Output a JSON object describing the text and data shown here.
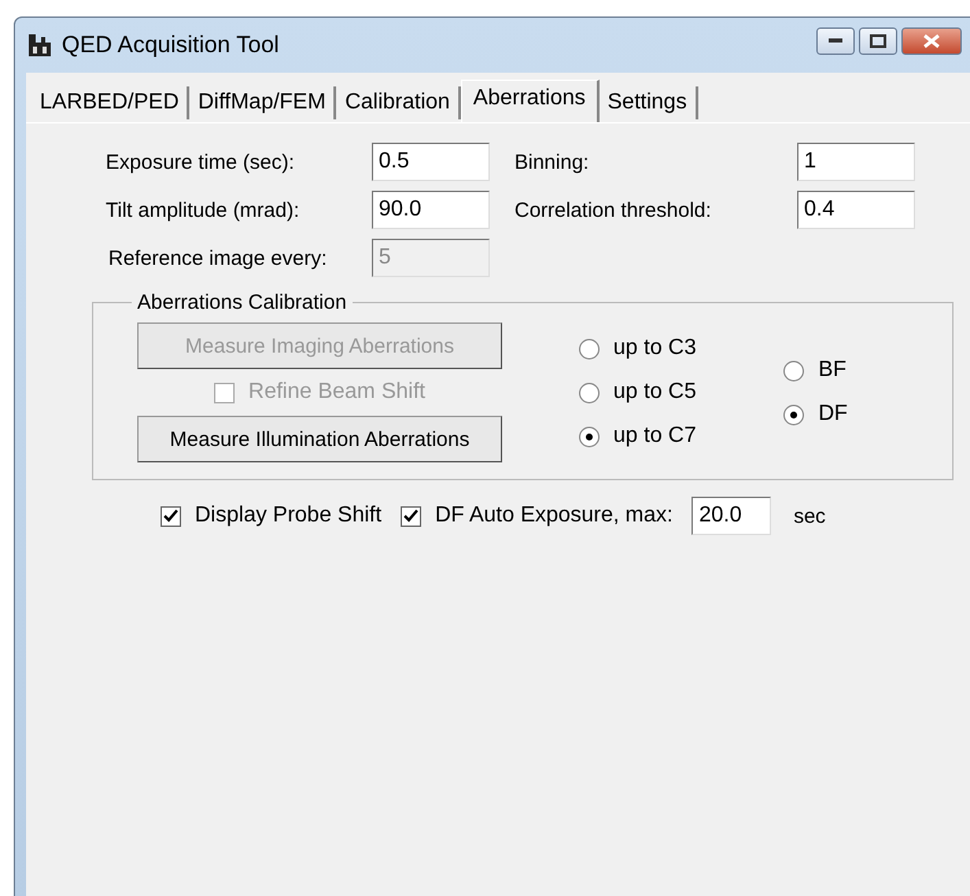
{
  "window": {
    "title": "QED Acquisition Tool"
  },
  "tabs": [
    {
      "label": "LARBED/PED",
      "selected": false
    },
    {
      "label": "DiffMap/FEM",
      "selected": false
    },
    {
      "label": "Calibration",
      "selected": false
    },
    {
      "label": "Aberrations",
      "selected": true
    },
    {
      "label": "Settings",
      "selected": false
    }
  ],
  "fields": [
    {
      "label": "Exposure time (sec):",
      "value": "0.5",
      "disabled": false
    },
    {
      "label": "Binning:",
      "value": "1",
      "disabled": false
    },
    {
      "label": "Tilt amplitude (mrad):",
      "value": "90.0",
      "disabled": false
    },
    {
      "label": "Correlation threshold:",
      "value": "0.4",
      "disabled": false
    },
    {
      "label": "Reference image every:",
      "value": "5",
      "disabled": true
    }
  ],
  "group": {
    "title": "Aberrations Calibration",
    "imaging_button": {
      "label": "Measure Imaging Aberrations",
      "disabled": true
    },
    "refine_checkbox": {
      "label": "Refine Beam Shift",
      "checked": false,
      "disabled": true
    },
    "illumination_button": {
      "label": "Measure Illumination Aberrations",
      "disabled": false
    },
    "order_radios": [
      {
        "label": "up to C3",
        "selected": false
      },
      {
        "label": "up to C5",
        "selected": false
      },
      {
        "label": "up to C7",
        "selected": true
      }
    ],
    "mode_radios": [
      {
        "label": "BF",
        "selected": false
      },
      {
        "label": "DF",
        "selected": true
      }
    ]
  },
  "bottom": {
    "probe_checkbox": {
      "label": "Display Probe Shift",
      "checked": true
    },
    "auto_checkbox": {
      "label": "DF Auto Exposure, max:",
      "checked": true
    },
    "max_value": "20.0",
    "unit": "sec"
  }
}
